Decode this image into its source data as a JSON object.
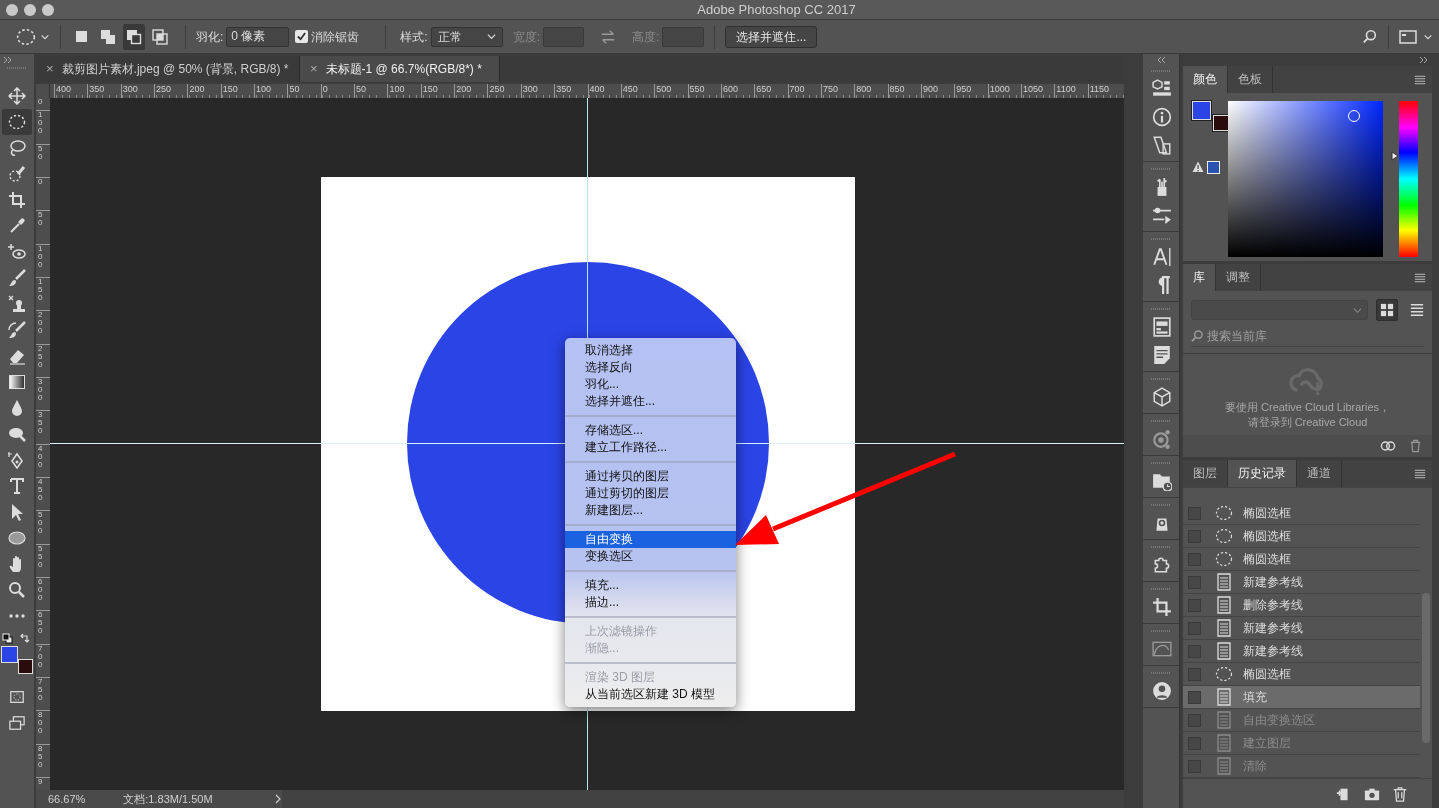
{
  "window": {
    "title": "Adobe Photoshop CC 2017"
  },
  "options_bar": {
    "selection_modes": [
      {
        "selected": false
      },
      {
        "selected": false
      },
      {
        "selected": true
      },
      {
        "selected": false
      }
    ],
    "feather": {
      "label": "羽化:",
      "value": "0 像素"
    },
    "anti_alias": {
      "label": "消除锯齿",
      "checked": true
    },
    "style": {
      "label": "样式:",
      "value": "正常"
    },
    "width": {
      "label": "宽度:",
      "disabled": true
    },
    "height": {
      "label": "高度:",
      "disabled": true
    },
    "refine_button": "选择并遮住..."
  },
  "document_tabs": [
    {
      "close": "×",
      "label": "裁剪图片素材.jpeg @ 50% (背景, RGB/8) *",
      "selected": false
    },
    {
      "close": "×",
      "label": "未标题-1 @ 66.7%(RGB/8*) *",
      "selected": true
    }
  ],
  "rulers": {
    "horizontal": [
      "400",
      "350",
      "300",
      "250",
      "200",
      "150",
      "100",
      "50",
      "0",
      "50",
      "100",
      "150",
      "200",
      "250",
      "300",
      "350",
      "400",
      "450",
      "500",
      "550",
      "600",
      "650",
      "700",
      "750",
      "800",
      "850",
      "900",
      "950",
      "1000",
      "1050",
      "1100",
      "1150"
    ],
    "vertical": [
      "0",
      "100",
      "50",
      "0",
      "50",
      "100",
      "150",
      "200",
      "250",
      "300",
      "350",
      "400",
      "450",
      "500",
      "550",
      "600",
      "650",
      "700",
      "750",
      "800",
      "850",
      "9"
    ]
  },
  "tools": [
    {
      "selected": false
    },
    {
      "selected": true
    },
    {
      "selected": false
    },
    {
      "selected": false
    },
    {
      "selected": false
    },
    {
      "selected": false
    },
    {
      "selected": false
    },
    {
      "selected": false
    },
    {
      "selected": false
    },
    {
      "selected": false
    },
    {
      "selected": false
    },
    {
      "selected": false
    },
    {
      "selected": false
    },
    {
      "selected": false
    },
    {
      "selected": false
    },
    {
      "selected": false
    },
    {
      "selected": false
    },
    {
      "selected": false
    },
    {
      "selected": false
    },
    {
      "selected": false
    },
    {
      "selected": false
    }
  ],
  "tool_swatches": [
    {
      "kind": "foreground",
      "color": "#2b44e6"
    },
    {
      "kind": "background",
      "color": "#2a0c0c"
    }
  ],
  "context_menu": {
    "groups": [
      {
        "items": [
          {
            "label": "取消选择",
            "disabled": false,
            "selected": false
          },
          {
            "label": "选择反向",
            "disabled": false,
            "selected": false
          },
          {
            "label": "羽化...",
            "disabled": false,
            "selected": false
          },
          {
            "label": "选择并遮住...",
            "disabled": false,
            "selected": false
          }
        ]
      },
      {
        "items": [
          {
            "label": "存储选区...",
            "disabled": false,
            "selected": false
          },
          {
            "label": "建立工作路径...",
            "disabled": false,
            "selected": false
          }
        ]
      },
      {
        "items": [
          {
            "label": "通过拷贝的图层",
            "disabled": false,
            "selected": false
          },
          {
            "label": "通过剪切的图层",
            "disabled": false,
            "selected": false
          },
          {
            "label": "新建图层...",
            "disabled": false,
            "selected": false
          }
        ]
      },
      {
        "items": [
          {
            "label": "自由变换",
            "disabled": false,
            "selected": true
          },
          {
            "label": "变换选区",
            "disabled": false,
            "selected": false
          }
        ]
      },
      {
        "items": [
          {
            "label": "填充...",
            "disabled": false,
            "selected": false
          },
          {
            "label": "描边...",
            "disabled": false,
            "selected": false
          }
        ]
      },
      {
        "items": [
          {
            "label": "上次滤镜操作",
            "disabled": true,
            "selected": false
          },
          {
            "label": "渐隐...",
            "disabled": true,
            "selected": false
          }
        ]
      },
      {
        "items": [
          {
            "label": "渲染 3D 图层",
            "disabled": true,
            "selected": false
          },
          {
            "label": "从当前选区新建 3D 模型",
            "disabled": false,
            "selected": false
          }
        ]
      }
    ]
  },
  "status_bar": {
    "zoom": "66.67%",
    "doc_size": "文档:1.83M/1.50M"
  },
  "color_panel": {
    "tabs": [
      {
        "label": "颜色",
        "selected": true
      },
      {
        "label": "色板",
        "selected": false
      }
    ],
    "swatches": [
      {
        "kind": "foreground",
        "color": "#2b44e6"
      },
      {
        "kind": "background",
        "color": "#2a0c0c"
      },
      {
        "kind": "gamut",
        "color": "#2a52b0"
      }
    ],
    "hue_slider": {
      "level": 0.65
    }
  },
  "library_panel": {
    "tabs": [
      {
        "label": "库",
        "selected": true
      },
      {
        "label": "调整",
        "selected": false
      }
    ],
    "views": [
      {
        "selected": true
      },
      {
        "selected": false
      }
    ],
    "search": {
      "placeholder": "搜索当前库"
    },
    "message": [
      "要使用 Creative Cloud Libraries，",
      "请登录到 Creative Cloud"
    ]
  },
  "history_panel": {
    "tabs": [
      {
        "label": "图层",
        "selected": false
      },
      {
        "label": "历史记录",
        "selected": true
      },
      {
        "label": "通道",
        "selected": false
      }
    ],
    "items": [
      {
        "label": "椭圆选框",
        "kind": "ellipse",
        "selected": false,
        "undone": false
      },
      {
        "label": "椭圆选框",
        "kind": "ellipse",
        "selected": false,
        "undone": false
      },
      {
        "label": "椭圆选框",
        "kind": "ellipse",
        "selected": false,
        "undone": false
      },
      {
        "label": "新建参考线",
        "kind": "document",
        "selected": false,
        "undone": false
      },
      {
        "label": "删除参考线",
        "kind": "document",
        "selected": false,
        "undone": false
      },
      {
        "label": "新建参考线",
        "kind": "document",
        "selected": false,
        "undone": false
      },
      {
        "label": "新建参考线",
        "kind": "document",
        "selected": false,
        "undone": false
      },
      {
        "label": "椭圆选框",
        "kind": "ellipse",
        "selected": false,
        "undone": false
      },
      {
        "label": "填充",
        "kind": "document",
        "selected": true,
        "undone": false
      },
      {
        "label": "自由变换选区",
        "kind": "document",
        "selected": false,
        "undone": true
      },
      {
        "label": "建立图层",
        "kind": "document",
        "selected": false,
        "undone": true
      },
      {
        "label": "清除",
        "kind": "document",
        "selected": false,
        "undone": true
      }
    ]
  }
}
